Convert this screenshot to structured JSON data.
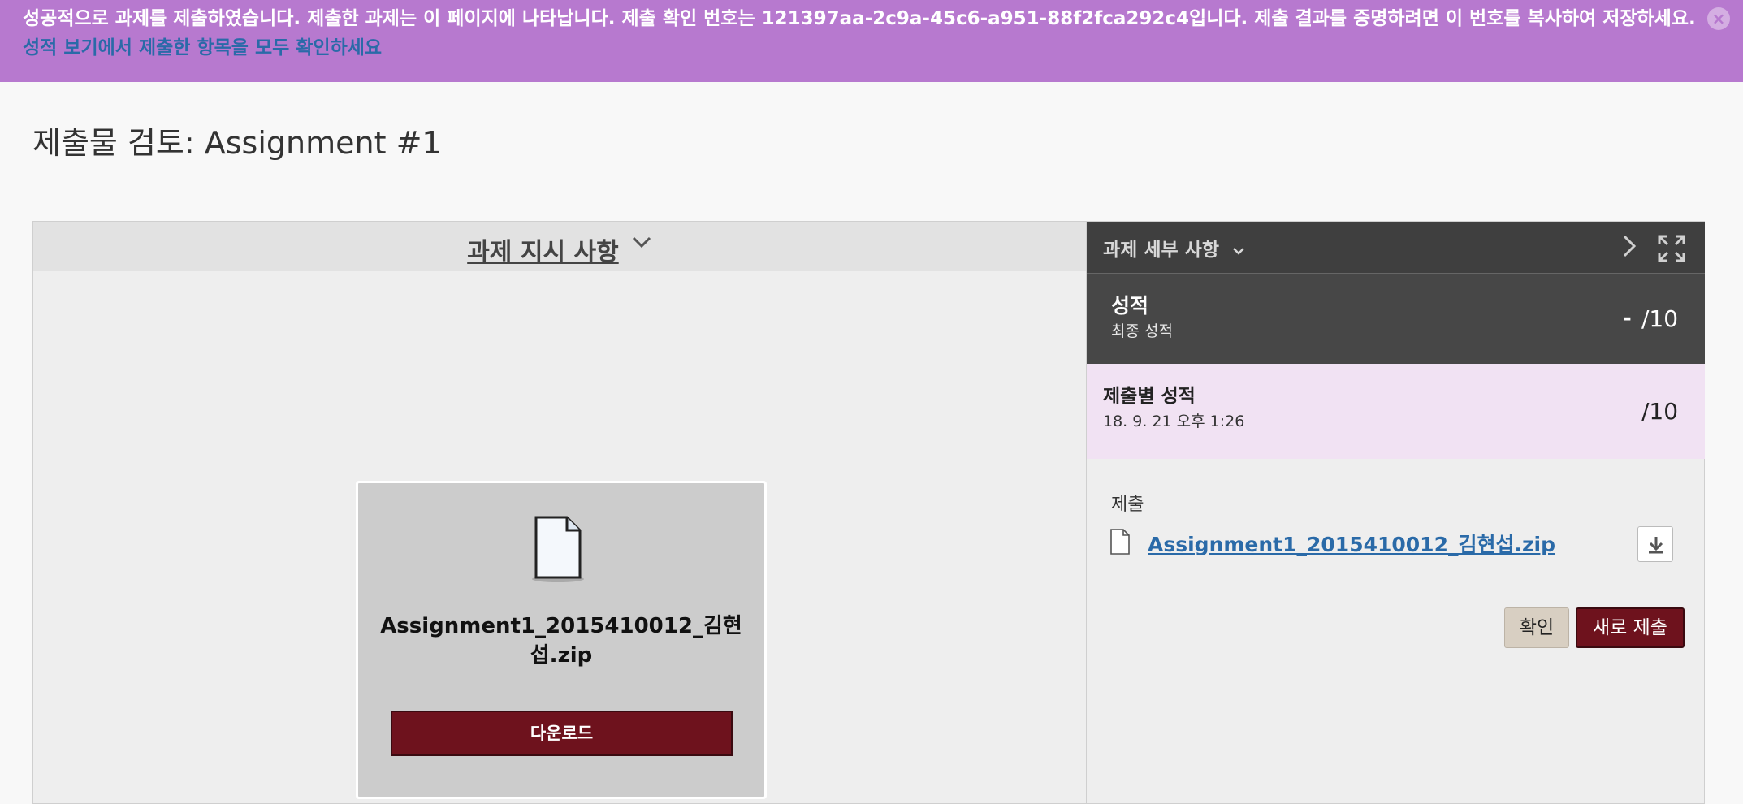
{
  "banner": {
    "message": "성공적으로 과제를 제출하였습니다. 제출한 과제는 이 페이지에 나타납니다. 제출 확인 번호는 121397aa-2c9a-45c6-a951-88f2fca292c4입니다. 제출 결과를 증명하려면 이 번호를 복사하여 저장하세요.",
    "link": "성적 보기에서 제출한 항목을 모두 확인하세요",
    "close_glyph": "×",
    "color": "#b779cf"
  },
  "page": {
    "title": "제출물 검토: Assignment #1"
  },
  "left_panel": {
    "header": "과제 지시 사항",
    "chevron": "⌄",
    "file_card": {
      "file_name": "Assignment1_2015410012_김현섭.zip",
      "download_label": "다운로드",
      "icon": "document-icon"
    }
  },
  "right_panel": {
    "header": "과제 세부 사항",
    "chevron": "⌄",
    "next_glyph": "›",
    "grade": {
      "title": "성적",
      "subtitle": "최종 성적",
      "dash": "-",
      "value": "/10"
    },
    "attempt": {
      "title": "제출별 성적",
      "date": "18. 9. 21 오후 1:26",
      "value": "/10"
    },
    "submission": {
      "label": "제출",
      "file_name": "Assignment1_2015410012_김현섭.zip"
    },
    "buttons": {
      "ok": "확인",
      "resubmit": "새로 제출"
    }
  },
  "colors": {
    "accent": "#6e121d",
    "link": "#2a6aa8",
    "header_dark": "#3f3f3f"
  }
}
